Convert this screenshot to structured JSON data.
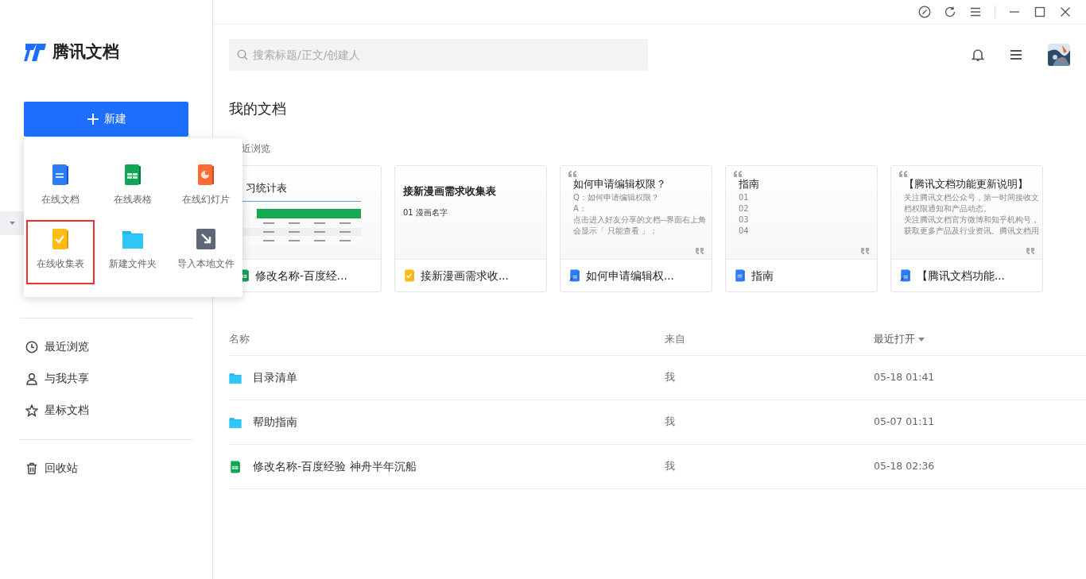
{
  "app": {
    "logo_text": "腾讯文档"
  },
  "sidebar": {
    "new_button": "新建",
    "nav": [
      {
        "kind": "clock",
        "label": "最近浏览"
      },
      {
        "kind": "person",
        "label": "与我共享"
      },
      {
        "kind": "star",
        "label": "星标文档"
      }
    ],
    "trash": {
      "kind": "trash",
      "label": "回收站"
    }
  },
  "new_menu": {
    "items": [
      {
        "kind": "doc",
        "label": "在线文档",
        "highlighted": false
      },
      {
        "kind": "sheet",
        "label": "在线表格",
        "highlighted": false
      },
      {
        "kind": "slide",
        "label": "在线幻灯片",
        "highlighted": false
      },
      {
        "kind": "form",
        "label": "在线收集表",
        "highlighted": true
      },
      {
        "kind": "folder",
        "label": "新建文件夹",
        "highlighted": false
      },
      {
        "kind": "import",
        "label": "导入本地文件",
        "highlighted": false
      }
    ]
  },
  "search": {
    "placeholder": "搜索标题/正文/创建人"
  },
  "section_title": "我的文档",
  "recent": {
    "label": "近浏览",
    "cards": [
      {
        "kind": "sheet",
        "title": "习统计表",
        "name": "修改名称-百度经..."
      },
      {
        "kind": "form",
        "title": "接新漫画需求收集表",
        "lines": [
          "01  漫画名字"
        ],
        "name": "接新漫画需求收..."
      },
      {
        "kind": "shared-doc",
        "title": "如何申请编辑权限？",
        "lines": [
          "Q：如何申请编辑权限？",
          "A：",
          "点击进入好友分享的文档--界面右上角",
          "会显示「 只能查看 」；"
        ],
        "name": "如何申请编辑权..."
      },
      {
        "kind": "doc",
        "title": "指南",
        "lines": [
          "01",
          "02",
          "03",
          "04"
        ],
        "name": "指南"
      },
      {
        "kind": "shared-doc",
        "title": "【腾讯文档功能更新说明】",
        "lines": [
          "关注腾讯文档公众号，第一时间接收文",
          "档权限通知和产品动态。",
          "关注腾讯文档官方微博和知乎机构号，",
          "获取更多产品及行业资讯。腾讯文档用"
        ],
        "name": "【腾讯文档功能..."
      }
    ]
  },
  "table": {
    "columns": [
      {
        "label": "名称",
        "sorted": false
      },
      {
        "label": "来自",
        "sorted": false
      },
      {
        "label": "最近打开",
        "sorted": true
      }
    ],
    "rows": [
      {
        "kind": "folder",
        "name": "目录清单",
        "from": "我",
        "opened": "05-18 01:41"
      },
      {
        "kind": "folder",
        "name": "帮助指南",
        "from": "我",
        "opened": "05-07 01:11"
      },
      {
        "kind": "sheet",
        "name": "修改名称-百度经验 神舟半年沉船",
        "from": "我",
        "opened": "05-18 02:36"
      }
    ]
  }
}
